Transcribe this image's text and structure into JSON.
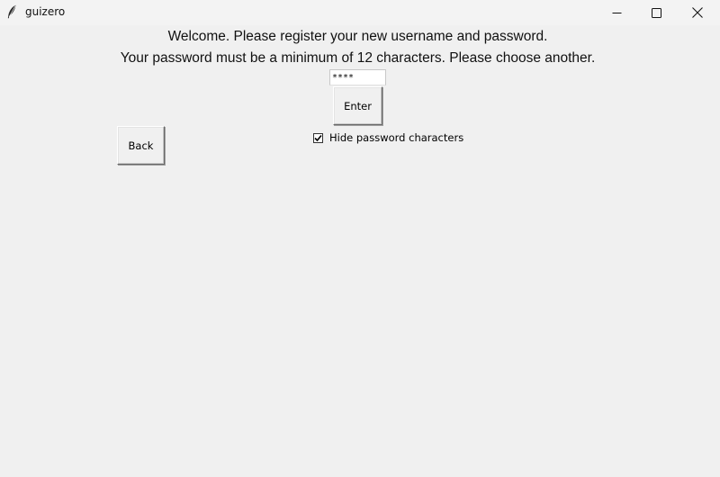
{
  "window": {
    "title": "guizero",
    "icon": "feather-icon",
    "controls": [
      "minimize-icon",
      "maximize-icon",
      "close-icon"
    ]
  },
  "messages": {
    "welcome": "Welcome. Please register your new username and password.",
    "error": "Your password must be a minimum of 12 characters. Please choose another."
  },
  "password_input": {
    "value": "****"
  },
  "buttons": {
    "enter": "Enter",
    "back": "Back"
  },
  "hide_password": {
    "label": "Hide password characters",
    "checked": true
  }
}
